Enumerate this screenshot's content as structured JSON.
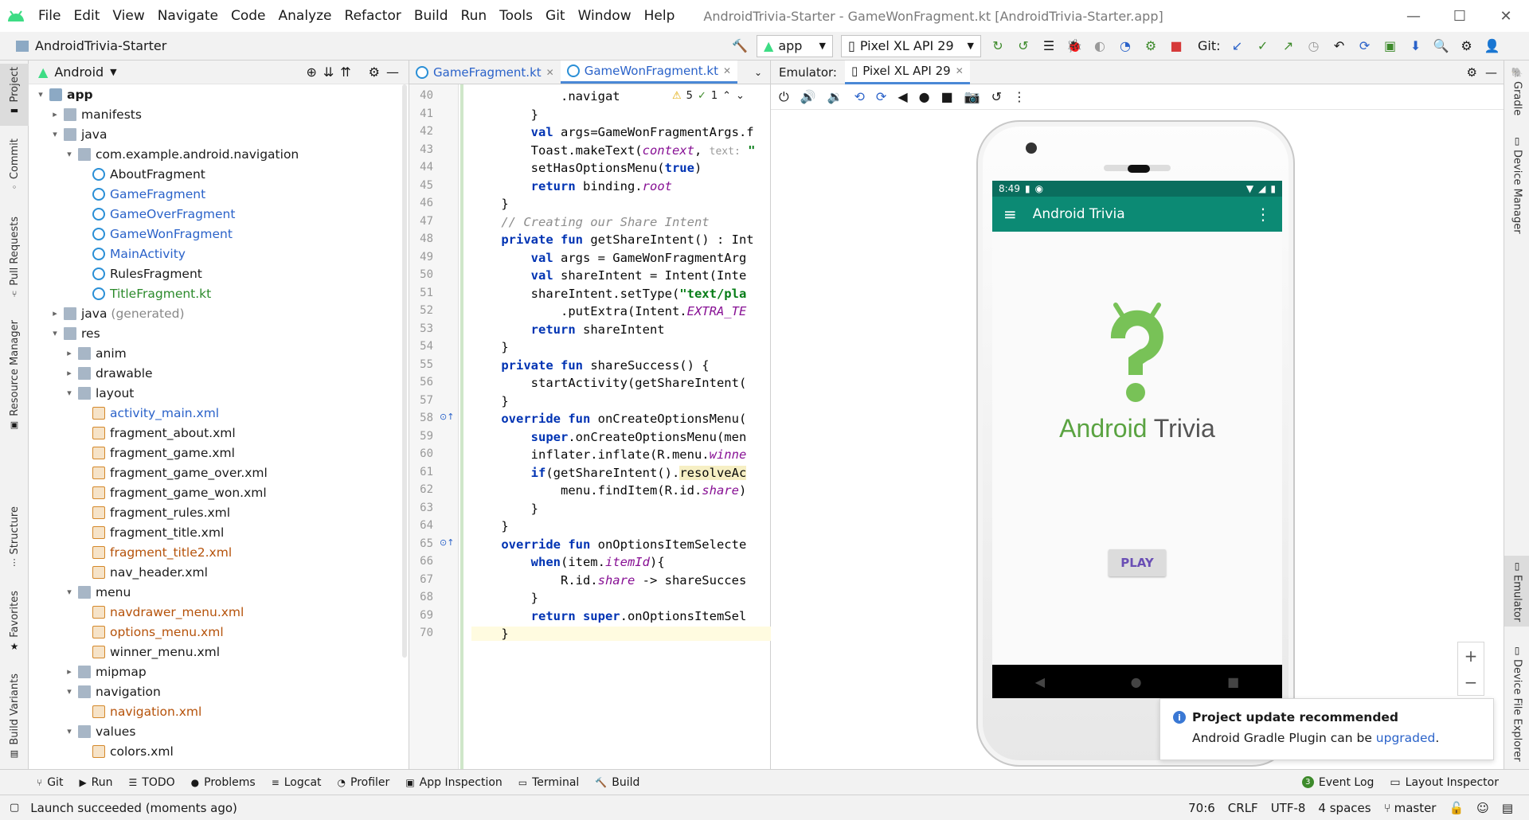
{
  "menubar": {
    "items": [
      "File",
      "Edit",
      "View",
      "Navigate",
      "Code",
      "Analyze",
      "Refactor",
      "Build",
      "Run",
      "Tools",
      "Git",
      "Window",
      "Help"
    ],
    "window_title": "AndroidTrivia-Starter - GameWonFragment.kt [AndroidTrivia-Starter.app]"
  },
  "navbar": {
    "project": "AndroidTrivia-Starter",
    "run_config": "app",
    "device": "Pixel XL API 29",
    "git_label": "Git:"
  },
  "left_tabs": {
    "project": "Project",
    "commit": "Commit",
    "pull_requests": "Pull Requests",
    "resource_manager": "Resource Manager",
    "structure": "Structure",
    "favorites": "Favorites",
    "build_variants": "Build Variants"
  },
  "right_tabs": {
    "gradle": "Gradle",
    "device_manager": "Device Manager",
    "emulator": "Emulator",
    "device_file_explorer": "Device File Explorer"
  },
  "project_panel": {
    "view": "Android",
    "tree": [
      {
        "label": "app",
        "depth": 0,
        "arrow": "▾",
        "icon": "mod",
        "style": "bold"
      },
      {
        "label": "manifests",
        "depth": 1,
        "arrow": "▸",
        "icon": "dir",
        "style": ""
      },
      {
        "label": "java",
        "depth": 1,
        "arrow": "▾",
        "icon": "dir",
        "style": ""
      },
      {
        "label": "com.example.android.navigation",
        "depth": 2,
        "arrow": "▾",
        "icon": "dir",
        "style": ""
      },
      {
        "label": "AboutFragment",
        "depth": 3,
        "arrow": "",
        "icon": "kt",
        "style": ""
      },
      {
        "label": "GameFragment",
        "depth": 3,
        "arrow": "",
        "icon": "kt",
        "style": "blue"
      },
      {
        "label": "GameOverFragment",
        "depth": 3,
        "arrow": "",
        "icon": "kt",
        "style": "blue"
      },
      {
        "label": "GameWonFragment",
        "depth": 3,
        "arrow": "",
        "icon": "kt",
        "style": "blue"
      },
      {
        "label": "MainActivity",
        "depth": 3,
        "arrow": "",
        "icon": "kt",
        "style": "blue"
      },
      {
        "label": "RulesFragment",
        "depth": 3,
        "arrow": "",
        "icon": "kt",
        "style": ""
      },
      {
        "label": "TitleFragment.kt",
        "depth": 3,
        "arrow": "",
        "icon": "kt",
        "style": "green"
      },
      {
        "label": "java (generated)",
        "depth": 1,
        "arrow": "▸",
        "icon": "dir",
        "style": "gen"
      },
      {
        "label": "res",
        "depth": 1,
        "arrow": "▾",
        "icon": "dir",
        "style": ""
      },
      {
        "label": "anim",
        "depth": 2,
        "arrow": "▸",
        "icon": "dir",
        "style": ""
      },
      {
        "label": "drawable",
        "depth": 2,
        "arrow": "▸",
        "icon": "dir",
        "style": ""
      },
      {
        "label": "layout",
        "depth": 2,
        "arrow": "▾",
        "icon": "dir",
        "style": ""
      },
      {
        "label": "activity_main.xml",
        "depth": 3,
        "arrow": "",
        "icon": "xml",
        "style": "blue"
      },
      {
        "label": "fragment_about.xml",
        "depth": 3,
        "arrow": "",
        "icon": "xml",
        "style": ""
      },
      {
        "label": "fragment_game.xml",
        "depth": 3,
        "arrow": "",
        "icon": "xml",
        "style": ""
      },
      {
        "label": "fragment_game_over.xml",
        "depth": 3,
        "arrow": "",
        "icon": "xml",
        "style": ""
      },
      {
        "label": "fragment_game_won.xml",
        "depth": 3,
        "arrow": "",
        "icon": "xml",
        "style": ""
      },
      {
        "label": "fragment_rules.xml",
        "depth": 3,
        "arrow": "",
        "icon": "xml",
        "style": ""
      },
      {
        "label": "fragment_title.xml",
        "depth": 3,
        "arrow": "",
        "icon": "xml",
        "style": ""
      },
      {
        "label": "fragment_title2.xml",
        "depth": 3,
        "arrow": "",
        "icon": "xml",
        "style": "orange"
      },
      {
        "label": "nav_header.xml",
        "depth": 3,
        "arrow": "",
        "icon": "xml",
        "style": ""
      },
      {
        "label": "menu",
        "depth": 2,
        "arrow": "▾",
        "icon": "dir",
        "style": ""
      },
      {
        "label": "navdrawer_menu.xml",
        "depth": 3,
        "arrow": "",
        "icon": "xml",
        "style": "orange"
      },
      {
        "label": "options_menu.xml",
        "depth": 3,
        "arrow": "",
        "icon": "xml",
        "style": "orange"
      },
      {
        "label": "winner_menu.xml",
        "depth": 3,
        "arrow": "",
        "icon": "xml",
        "style": ""
      },
      {
        "label": "mipmap",
        "depth": 2,
        "arrow": "▸",
        "icon": "dir",
        "style": ""
      },
      {
        "label": "navigation",
        "depth": 2,
        "arrow": "▾",
        "icon": "dir",
        "style": ""
      },
      {
        "label": "navigation.xml",
        "depth": 3,
        "arrow": "",
        "icon": "xml",
        "style": "orange"
      },
      {
        "label": "values",
        "depth": 2,
        "arrow": "▾",
        "icon": "dir",
        "style": ""
      },
      {
        "label": "colors.xml",
        "depth": 3,
        "arrow": "",
        "icon": "xml",
        "style": ""
      }
    ]
  },
  "editor": {
    "tabs": [
      "GameFragment.kt",
      "GameWonFragment.kt"
    ],
    "inspections": {
      "warnings": "5",
      "weak": "1"
    },
    "code": [
      {
        "n": "40",
        "html": "            .navigat"
      },
      {
        "n": "41",
        "html": "        }"
      },
      {
        "n": "42",
        "html": "        <span class=\"kw\">val</span> args=GameWonFragmentArgs.f"
      },
      {
        "n": "43",
        "html": "        Toast.makeText(<span class=\"it\">context</span>, <span class=\"hint\">text:</span> <span class=\"str\">\"</span>"
      },
      {
        "n": "44",
        "html": "        setHasOptionsMenu(<span class=\"kw\">true</span>)"
      },
      {
        "n": "45",
        "html": "        <span class=\"kw\">return</span> binding.<span class=\"it\">root</span>"
      },
      {
        "n": "46",
        "html": "    }"
      },
      {
        "n": "47",
        "html": "    <span class=\"cm\">// Creating our Share Intent</span>"
      },
      {
        "n": "48",
        "html": "    <span class=\"kw\">private fun</span> getShareIntent() : Int"
      },
      {
        "n": "49",
        "html": "        <span class=\"kw\">val</span> args = GameWonFragmentArg"
      },
      {
        "n": "50",
        "html": "        <span class=\"kw\">val</span> shareIntent = Intent(Inte"
      },
      {
        "n": "51",
        "html": "        shareIntent.setType(<span class=\"str\">\"text/pla</span>"
      },
      {
        "n": "52",
        "html": "            .putExtra(Intent.<span class=\"it\">EXTRA_TE</span>"
      },
      {
        "n": "53",
        "html": "        <span class=\"kw\">return</span> shareIntent"
      },
      {
        "n": "54",
        "html": "    }"
      },
      {
        "n": "55",
        "html": "    <span class=\"kw\">private fun</span> shareSuccess() {"
      },
      {
        "n": "56",
        "html": "        startActivity(getShareIntent("
      },
      {
        "n": "57",
        "html": "    }"
      },
      {
        "n": "58",
        "html": "    <span class=\"kw\">override fun</span> onCreateOptionsMenu("
      },
      {
        "n": "59",
        "html": "        <span class=\"kw\">super</span>.onCreateOptionsMenu(men"
      },
      {
        "n": "60",
        "html": "        inflater.inflate(R.menu.<span class=\"it\">winne</span>"
      },
      {
        "n": "61",
        "html": "        <span class=\"kw\">if</span>(getShareIntent().<span style=\"background:#f6efc4\">resolveAc</span>"
      },
      {
        "n": "62",
        "html": "            menu.findItem(R.id.<span class=\"it\">share</span>)"
      },
      {
        "n": "63",
        "html": "        }"
      },
      {
        "n": "64",
        "html": "    }"
      },
      {
        "n": "65",
        "html": "    <span class=\"kw\">override fun</span> onOptionsItemSelecte"
      },
      {
        "n": "66",
        "html": "        <span class=\"kw\">when</span>(item.<span class=\"it\">itemId</span>){"
      },
      {
        "n": "67",
        "html": "            R.id.<span class=\"it\">share</span> -> shareSucces"
      },
      {
        "n": "68",
        "html": "        }"
      },
      {
        "n": "69",
        "html": "        <span class=\"kw\">return super</span>.onOptionsItemSel"
      },
      {
        "n": "70",
        "html": "    }"
      }
    ]
  },
  "emulator": {
    "label": "Emulator:",
    "device_tab": "Pixel XL API 29"
  },
  "phone": {
    "time": "8:49",
    "app_title": "Android Trivia",
    "logo_word1": "Android",
    "logo_word2": "Trivia",
    "play": "PLAY"
  },
  "notification": {
    "title": "Project update recommended",
    "body": "Android Gradle Plugin can be ",
    "link": "upgraded",
    "tail": "."
  },
  "toolwindows": {
    "left": [
      "Git",
      "Run",
      "TODO",
      "Problems",
      "Logcat",
      "Profiler",
      "App Inspection",
      "Terminal",
      "Build"
    ],
    "right": [
      "Event Log",
      "Layout Inspector"
    ],
    "event_count": "3"
  },
  "statusbar": {
    "message": "Launch succeeded (moments ago)",
    "position": "70:6",
    "line_sep": "CRLF",
    "encoding": "UTF-8",
    "indent": "4 spaces",
    "branch": "master"
  }
}
